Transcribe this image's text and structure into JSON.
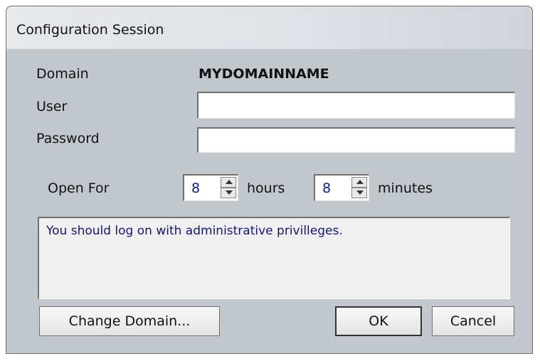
{
  "window": {
    "title": "Configuration Session"
  },
  "form": {
    "domain_label": "Domain",
    "domain_value": "MYDOMAINNAME",
    "user_label": "User",
    "user_value": "",
    "password_label": "Password",
    "password_value": "",
    "open_for_label": "Open For",
    "hours_value": "8",
    "hours_label": "hours",
    "minutes_value": "8",
    "minutes_label": "minutes"
  },
  "message": {
    "text": "You should log on with administrative privilleges."
  },
  "buttons": {
    "change_domain": "Change Domain...",
    "ok": "OK",
    "cancel": "Cancel"
  },
  "icons": {
    "spin_up": "chevron-up-icon",
    "spin_down": "chevron-down-icon"
  }
}
